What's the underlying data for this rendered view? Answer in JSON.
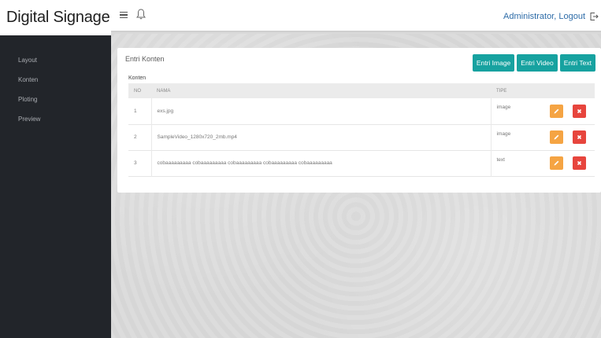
{
  "app": {
    "title": "Digital Signage"
  },
  "sidebar": {
    "items": [
      {
        "label": "Layout"
      },
      {
        "label": "Konten"
      },
      {
        "label": "Ploting"
      },
      {
        "label": "Preview"
      }
    ]
  },
  "header": {
    "user_text": "Administrator, Logout",
    "icons": [
      "hamburger-icon",
      "bell-icon",
      "logout-icon"
    ]
  },
  "panel": {
    "title": "Entri Konten",
    "buttons": {
      "entri_image": "Entri Image",
      "entri_video": "Entri Video",
      "entri_text": "Entri Text"
    },
    "section_label": "Konten",
    "table": {
      "headers": {
        "no": "NO",
        "nama": "NAMA",
        "tipe": "TIPE"
      },
      "rows": [
        {
          "no": "1",
          "nama": "exs.jpg",
          "tipe": "image"
        },
        {
          "no": "2",
          "nama": "SampleVideo_1280x720_2mb.mp4",
          "tipe": "image"
        },
        {
          "no": "3",
          "nama": "cobaaaaaaaaa cobaaaaaaaaa cobaaaaaaaaa cobaaaaaaaaa cobaaaaaaaaa",
          "tipe": "text"
        }
      ]
    }
  },
  "colors": {
    "sidebar_bg": "#22252a",
    "accent_teal": "#17a2a0",
    "edit_orange": "#f5a443",
    "delete_red": "#e7453d",
    "link_blue": "#2e6ca8"
  }
}
